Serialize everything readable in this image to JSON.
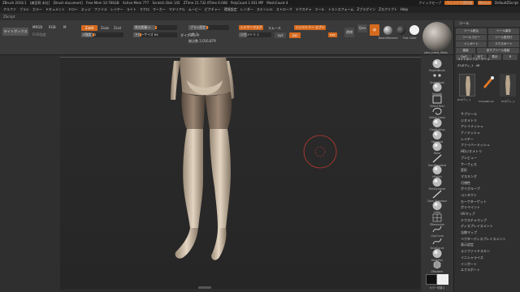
{
  "titlebar": {
    "app": "ZBrush 2018.1",
    "project": "[森宮莉 本社]",
    "doc": "[Brush document]",
    "free_mem": "Free Mem 10.766GB",
    "active_mem": "Active Mem 777",
    "scratch": "Scratch Disk 145",
    "time": "ZTime 21.732 ATime 6.008",
    "polycount": "PolyCount 1.931 MP",
    "meshcount": "MeshCount 4",
    "quicksave": "クイックセーブ",
    "transparency": "ウィンドウ透明度",
    "menu_btn": "Menus",
    "default_script": "DefaultZScript"
  },
  "menubar": [
    "アルファ",
    "ブラシ",
    "カラー",
    "ドキュメント",
    "ドロー",
    "エッジ",
    "ファイル",
    "レイヤー",
    "ライト",
    "マクロ",
    "マーカー",
    "マテリアル",
    "ムービー",
    "ピクチャー",
    "環境設定",
    "レンダー",
    "ステンシル",
    "ストローク",
    "テクスチャ",
    "ツール",
    "トランスフォーム",
    "Zプラグイン",
    "Zスクリプト",
    "Help"
  ],
  "scriptbar": "ZScript",
  "toolbar": {
    "lightbox": "ライトボックス",
    "rgb_label": "RGB",
    "m_label": "M",
    "mrgb_label": "MRGB",
    "zadd": "Zadd",
    "zsub": "Zsub",
    "zcut": "Zcut",
    "rgb_intensity_label": "RGB強度",
    "z_intensity": "Z強度 25",
    "focal_shift": "焦点距離 0",
    "draw_size": "ドローサイズ 64",
    "dynamic": "ダイナミック",
    "brush_size": "ブラシ設定 0",
    "active_points": "点数 0",
    "total_points": "総点数 2,016,879",
    "layer_label": "レイヤーマスク",
    "smooth_label": "スムース",
    "symmetry": "シンメトリー スプシ",
    "subdiv": "ジオメトリ 1",
    "xyz": "xyz",
    "local": "Loc",
    "qvis_btn": "Qvis",
    "perspective": "透視",
    "floor": "床",
    "material_label": "BasicMaterial",
    "gradient_label": "Gradient",
    "flatcolor_label": "Flat Color",
    "zbrush_default": "zbro_head_00bb"
  },
  "right_shelf": [
    {
      "label": "ProjectBrush"
    },
    {
      "label": "SnakeHook"
    },
    {
      "label": "Smooth"
    },
    {
      "label": "Select Rect"
    },
    {
      "label": "Select Lasso"
    },
    {
      "label": "ClayBuildup"
    },
    {
      "label": "Standard"
    },
    {
      "label": "Move"
    },
    {
      "label": "DamStandard"
    },
    {
      "label": "hPolish"
    },
    {
      "label": "TrimDynamic"
    },
    {
      "label": "Dam_Standard"
    },
    {
      "label": "Inflat"
    },
    {
      "label": "ZRemesher"
    },
    {
      "label": "ClipCurve"
    },
    {
      "label": "SliceCurve"
    },
    {
      "label": "MaskPen"
    },
    {
      "label": "ZModeler"
    }
  ],
  "rshelf_bottom": "カラー切替え",
  "right_panel": {
    "title": "ツール",
    "buttons": [
      "ツール読込",
      "ツール保存",
      "ツールコピー",
      "ツール貼付け",
      "インポート",
      "エクスポート",
      "複製",
      "全サブツール複製",
      "GoZ",
      "全て",
      "表示",
      "R"
    ],
    "lightbox_tool": "ライトボックス › ツール",
    "tool_name": "Z1ボディ_1 . 48",
    "thumb_label_1": "Z1ボディ_1",
    "thumb_label_2": "SimpleBrush",
    "thumb_label_3": "Z1ボディ_1",
    "menu": [
      "サブツール",
      "ジオメトリ",
      "アレイメッシュ",
      "ナノメッシュ",
      "レイヤー",
      "ファイバーメッシュ",
      "HDジオメトリ",
      "プレビュー",
      "サーフェス",
      "変形",
      "マスキング",
      "可視性",
      "ポリグループ",
      "コンタクト",
      "モーフターゲット",
      "ポリペイント",
      "UVマップ",
      "テクスチャマップ",
      "ディスプレイスメント",
      "法線マップ",
      "ベクターディスプレイスメント",
      "表示設定",
      "ユニファイドスキン",
      "イニシャライズ",
      "インポート",
      "エクスポート"
    ]
  }
}
